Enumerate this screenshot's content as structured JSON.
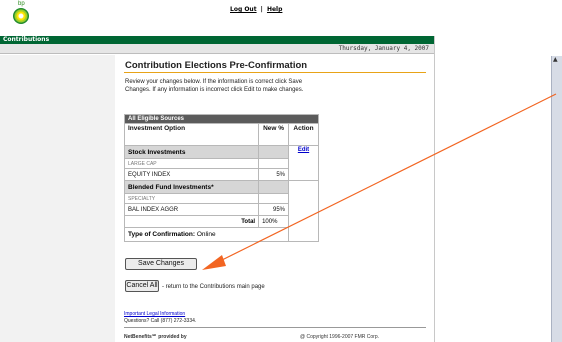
{
  "brand": {
    "logo_text": "bp",
    "color": "#006633"
  },
  "header": {
    "logout_label": "Log Out",
    "separator": "|",
    "help_label": "Help",
    "nav_title": "Contributions",
    "date": "Thursday, January 4, 2007"
  },
  "main": {
    "title": "Contribution Elections Pre-Confirmation",
    "intro": "Review your changes below. If the information is correct click Save Changes. If any information is incorrect click Edit to make changes.",
    "table": {
      "section_title": "All Eligible Sources",
      "columns": [
        "Investment Option",
        "New %",
        "Action"
      ],
      "edit_label": "Edit",
      "groups": [
        {
          "name": "Stock Investments",
          "category": "LARGE CAP",
          "funds": [
            {
              "name": "EQUITY INDEX",
              "percent": "5%"
            }
          ]
        },
        {
          "name": "Blended Fund Investments*",
          "category": "SPECIALTY",
          "funds": [
            {
              "name": "BAL INDEX AGGR",
              "percent": "95%"
            }
          ]
        }
      ],
      "total_label": "Total",
      "total_value": "100%",
      "confirmation_label": "Type of Confirmation:",
      "confirmation_value": "Online"
    },
    "save_label": "Save Changes",
    "cancel_label": "Cancel All",
    "cancel_note": "- return to the Contributions main page"
  },
  "footer": {
    "legal_link": "Important Legal Information",
    "questions": "Questions? Call (877) 272-3334.",
    "provided_by": "NetBenefits℠ provided by",
    "copyright": "@ Copyright 1996-2007 FMR Corp."
  },
  "annotation": {
    "arrow_color": "#f26522"
  }
}
